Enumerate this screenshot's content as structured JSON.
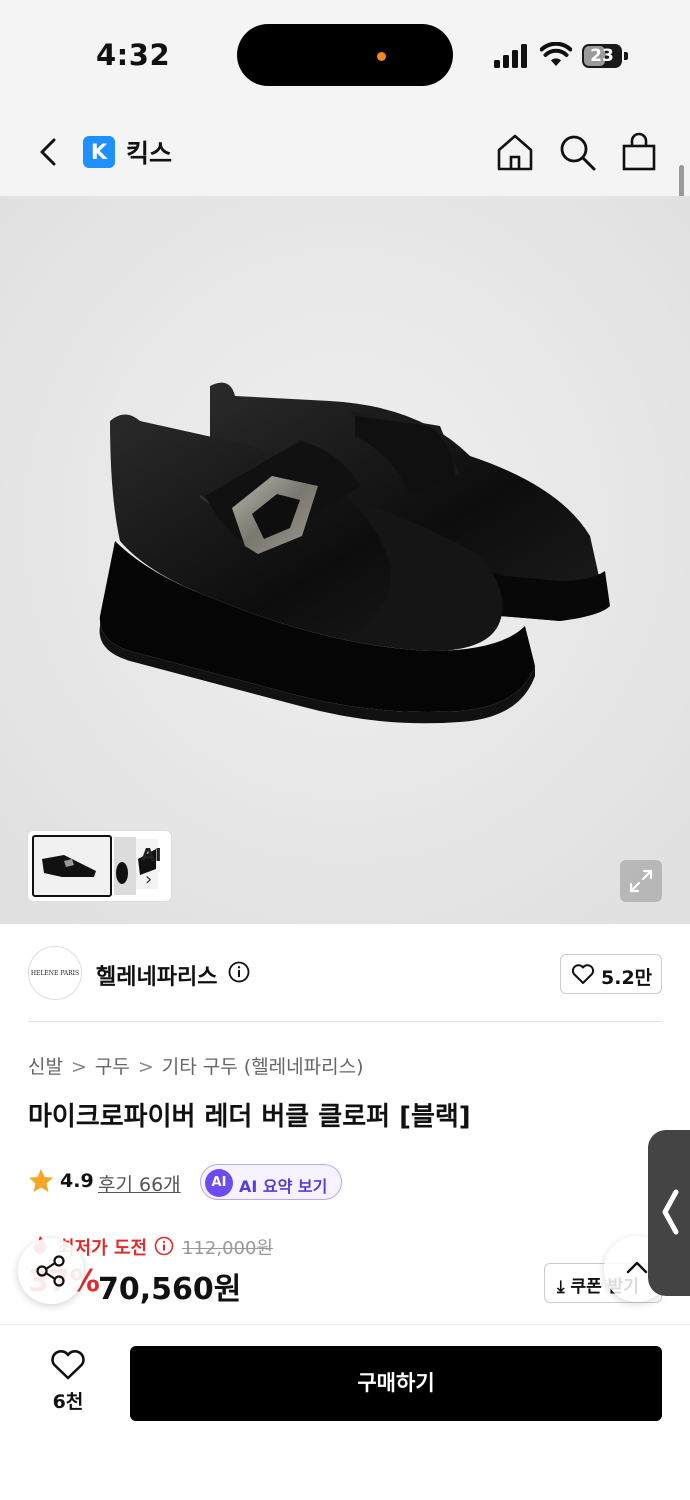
{
  "status_bar": {
    "time": "4:32",
    "battery": "23"
  },
  "nav": {
    "brand_logo_letter": "K",
    "title": "킥스"
  },
  "gallery": {
    "ai_label": "AI",
    "ai_chevron": "›"
  },
  "brand": {
    "avatar_text": "HELENE PARIS",
    "name": "헬레네파리스",
    "like_count": "5.2만"
  },
  "product": {
    "breadcrumb": [
      "신발",
      "구두",
      "기타 구두 (헬레네파리스)"
    ],
    "breadcrumb_sep": ">",
    "title": "마이크로파이버 레더 버클 클로퍼 [블랙]",
    "rating": "4.9",
    "reviews": "후기 66개",
    "ai_badge": "AI",
    "ai_summary": "AI 요약 보기",
    "deal_label": "최저가 도전",
    "original_price": "112,000원",
    "discount": "37%",
    "sale_price": "70,560원",
    "coupon": "쿠폰 받기"
  },
  "bottom": {
    "wish_count": "6천",
    "buy_label": "구매하기"
  },
  "colors": {
    "accent_red": "#e22b2b",
    "brand_blue": "#1e90ff",
    "ai_purple": "#6c4cf0",
    "star": "#f5a623"
  }
}
